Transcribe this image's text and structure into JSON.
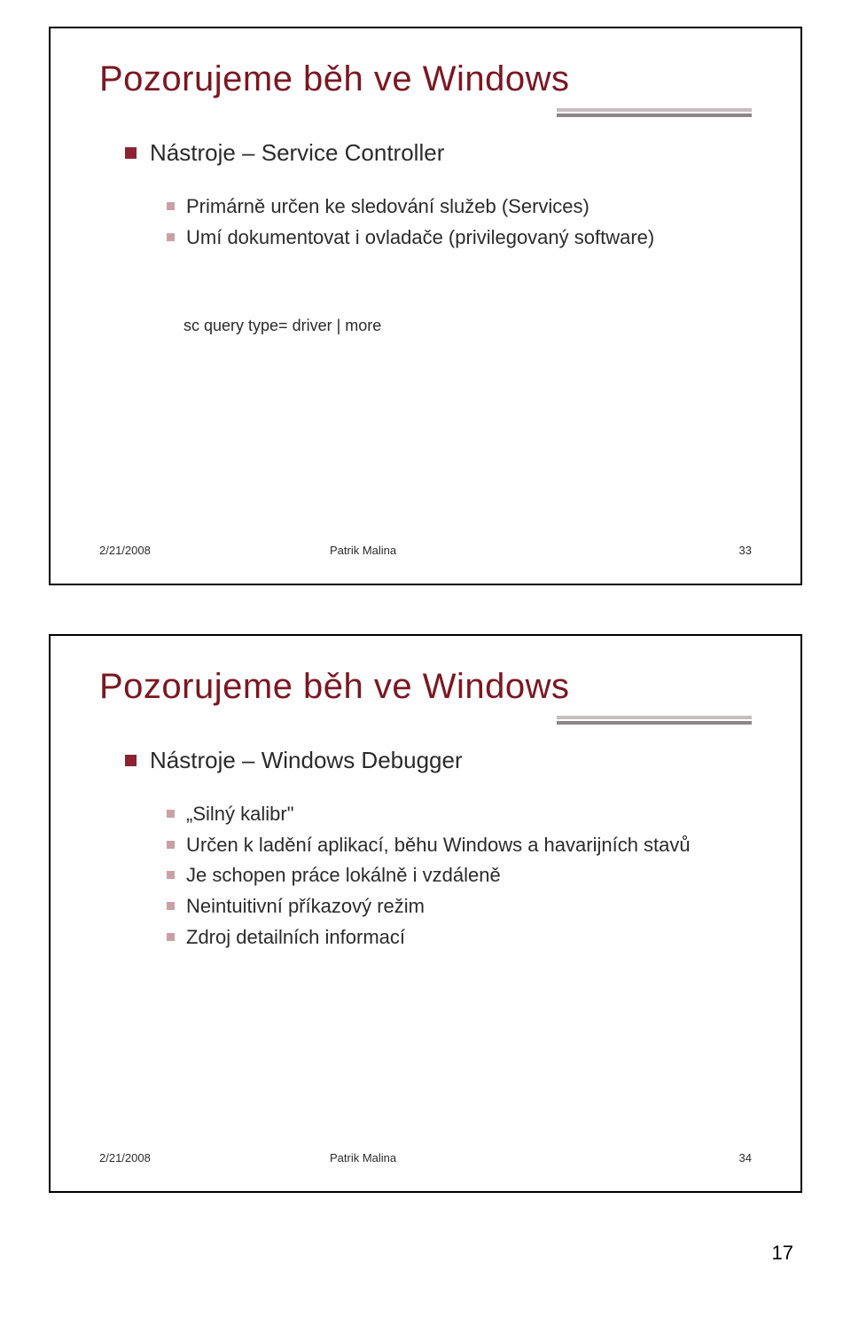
{
  "slides": [
    {
      "title": "Pozorujeme běh ve Windows",
      "bullets_level1": [
        "Nástroje – Service Controller"
      ],
      "bullets_level2": [
        "Primárně určen ke sledování služeb (Services)",
        "Umí dokumentovat i ovladače (privilegovaný software)"
      ],
      "code": "sc query type= driver | more",
      "footer": {
        "date": "2/21/2008",
        "author": "Patrik Malina",
        "num": "33"
      }
    },
    {
      "title": "Pozorujeme běh ve Windows",
      "bullets_level1": [
        "Nástroje – Windows Debugger"
      ],
      "bullets_level2": [
        "„Silný kalibr\"",
        "Určen k ladění aplikací, běhu Windows a havarijních stavů",
        "Je schopen práce lokálně i vzdáleně",
        "Neintuitivní příkazový režim",
        "Zdroj detailních informací"
      ],
      "footer": {
        "date": "2/21/2008",
        "author": "Patrik Malina",
        "num": "34"
      }
    }
  ],
  "page_number": "17"
}
